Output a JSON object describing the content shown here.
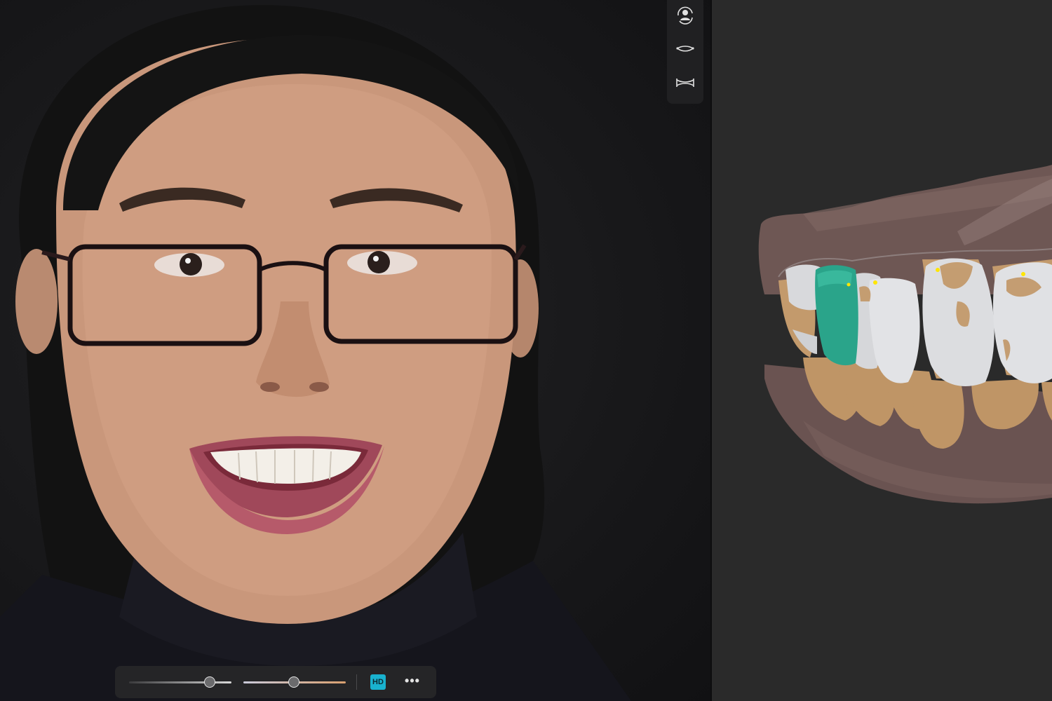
{
  "toolbar": {
    "hd_label": "HD",
    "more_label": "•••",
    "slider_1_value": 0.79,
    "slider_2_value": 0.49
  },
  "side_tools": [
    "face-rotate-icon",
    "lip-curve-icon",
    "arch-width-icon"
  ],
  "colors": {
    "accent": "#19b2cf",
    "selected_tooth": "#2aa48a",
    "gingiva": "#6e5754",
    "prep_tooth": "#c39a6c",
    "restoration": "#d6d7da",
    "marker": "#ffe600"
  }
}
